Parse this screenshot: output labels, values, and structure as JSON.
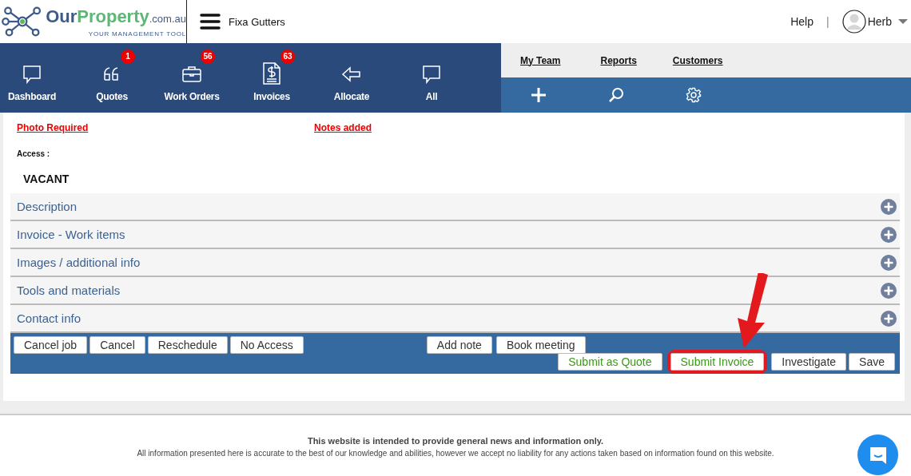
{
  "header": {
    "logo": {
      "brand_part1": "Our",
      "brand_part2": "Property",
      "domain": ".com.au",
      "tagline": "YOUR MANAGEMENT TOOL"
    },
    "company": "Fixa Gutters",
    "help": "Help",
    "separator": "|",
    "user": "Herb"
  },
  "nav": [
    {
      "label": "Dashboard"
    },
    {
      "label": "Quotes",
      "badge": "1"
    },
    {
      "label": "Work Orders",
      "badge": "56"
    },
    {
      "label": "Invoices",
      "badge": "63"
    },
    {
      "label": "Allocate"
    },
    {
      "label": "All"
    }
  ],
  "links": [
    "My Team",
    "Reports",
    "Customers"
  ],
  "flags": [
    "Photo Required",
    "Notes added"
  ],
  "access": {
    "label": "Access :",
    "value": "VACANT"
  },
  "sections": [
    {
      "title": "Description",
      "expanded": false
    },
    {
      "title": "Invoice - Work items",
      "expanded": false
    },
    {
      "title": "Images / additional info",
      "expanded": false
    },
    {
      "title": "Tools and materials",
      "expanded": false
    },
    {
      "title": "Contact info",
      "expanded": false
    }
  ],
  "actions_left": [
    {
      "label": "Cancel job",
      "kind": "default",
      "highlighted": false
    },
    {
      "label": "Cancel",
      "kind": "default",
      "highlighted": false
    },
    {
      "label": "Reschedule",
      "kind": "default",
      "highlighted": false
    },
    {
      "label": "No Access",
      "kind": "default",
      "highlighted": false
    }
  ],
  "actions_middle": [
    {
      "label": "Add note",
      "kind": "default",
      "highlighted": false
    },
    {
      "label": "Book meeting",
      "kind": "default",
      "highlighted": false
    }
  ],
  "actions_right": [
    {
      "label": "Submit as Quote",
      "kind": "submit",
      "highlighted": false
    },
    {
      "label": "Submit Invoice",
      "kind": "submit",
      "highlighted": true
    },
    {
      "label": "Investigate",
      "kind": "default",
      "highlighted": false
    },
    {
      "label": "Save",
      "kind": "default",
      "highlighted": false
    }
  ],
  "footer": {
    "heading": "This website is intended to provide general news and information only.",
    "text": "All information presented here is accurate to the best of our knowledge and abilities, however we accept no liability for any actions taken based on information found on this website."
  }
}
